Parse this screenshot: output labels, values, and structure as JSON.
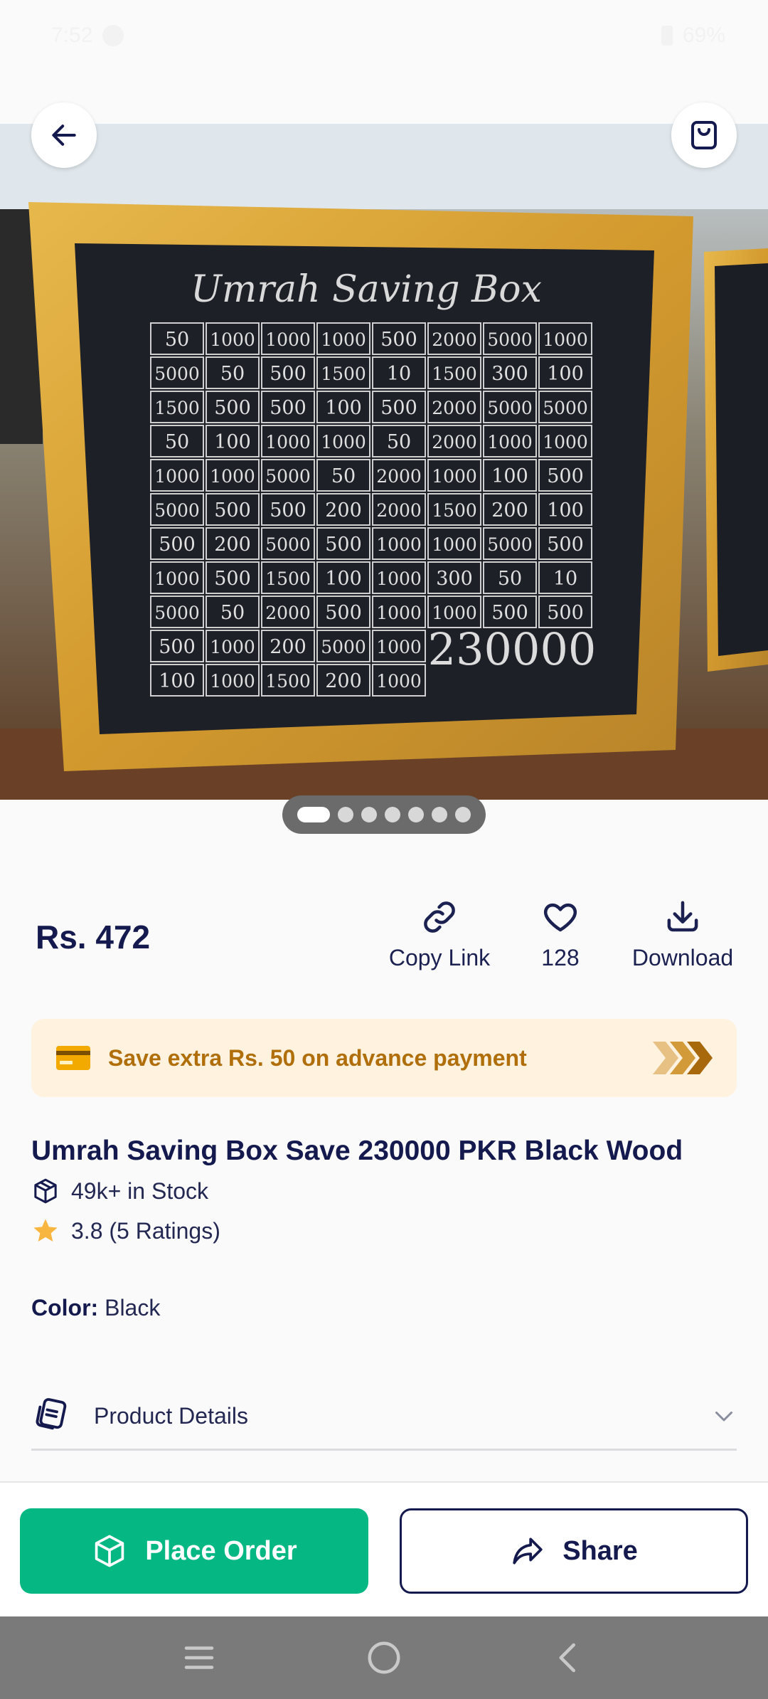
{
  "status_bar": {
    "time": "7:52",
    "battery": "69%"
  },
  "product": {
    "image_texts": {
      "box_heading": "Umrah Saving Box",
      "grid_rows": [
        [
          "50",
          "1000",
          "1000",
          "1000",
          "500",
          "2000",
          "5000",
          "1000"
        ],
        [
          "5000",
          "50",
          "500",
          "1500",
          "10",
          "1500",
          "300",
          "100"
        ],
        [
          "1500",
          "500",
          "500",
          "100",
          "500",
          "2000",
          "5000",
          "5000"
        ],
        [
          "50",
          "100",
          "1000",
          "1000",
          "50",
          "2000",
          "1000",
          "1000"
        ],
        [
          "1000",
          "1000",
          "5000",
          "50",
          "2000",
          "1000",
          "100",
          "500"
        ],
        [
          "5000",
          "500",
          "500",
          "200",
          "2000",
          "1500",
          "200",
          "100"
        ],
        [
          "500",
          "200",
          "5000",
          "500",
          "1000",
          "1000",
          "5000",
          "500"
        ],
        [
          "1000",
          "500",
          "1500",
          "100",
          "1000",
          "300",
          "50",
          "10"
        ],
        [
          "5000",
          "50",
          "2000",
          "500",
          "1000",
          "1000",
          "500",
          "500"
        ],
        [
          "500",
          "1000",
          "200",
          "5000",
          "1000"
        ],
        [
          "100",
          "1000",
          "1500",
          "200",
          "1000"
        ]
      ],
      "total": "230000"
    },
    "gallery": {
      "image_count": 7,
      "active_index": 0
    },
    "price": "Rs. 472",
    "actions": {
      "copy_link": "Copy Link",
      "likes": "128",
      "download": "Download"
    },
    "promo": {
      "text": "Save extra Rs. 50 on advance payment"
    },
    "title": "Umrah Saving Box Save 230000 PKR Black Wood",
    "stock": "49k+ in Stock",
    "rating": "3.8 (5 Ratings)",
    "color": {
      "label": "Color:",
      "value": "Black"
    },
    "details_label": "Product Details"
  },
  "bottom_bar": {
    "place_order": "Place Order",
    "share": "Share"
  },
  "colors": {
    "accent_green": "#05b883",
    "navy": "#141a4d",
    "promo_bg": "#fff2df",
    "promo_text": "#b06f0a"
  },
  "icons": [
    "back-arrow-icon",
    "shopping-bag-icon",
    "link-icon",
    "heart-icon",
    "download-icon",
    "card-icon",
    "chevrons-icon",
    "box-icon",
    "star-icon",
    "details-icon",
    "chevron-down-icon",
    "share-icon"
  ]
}
